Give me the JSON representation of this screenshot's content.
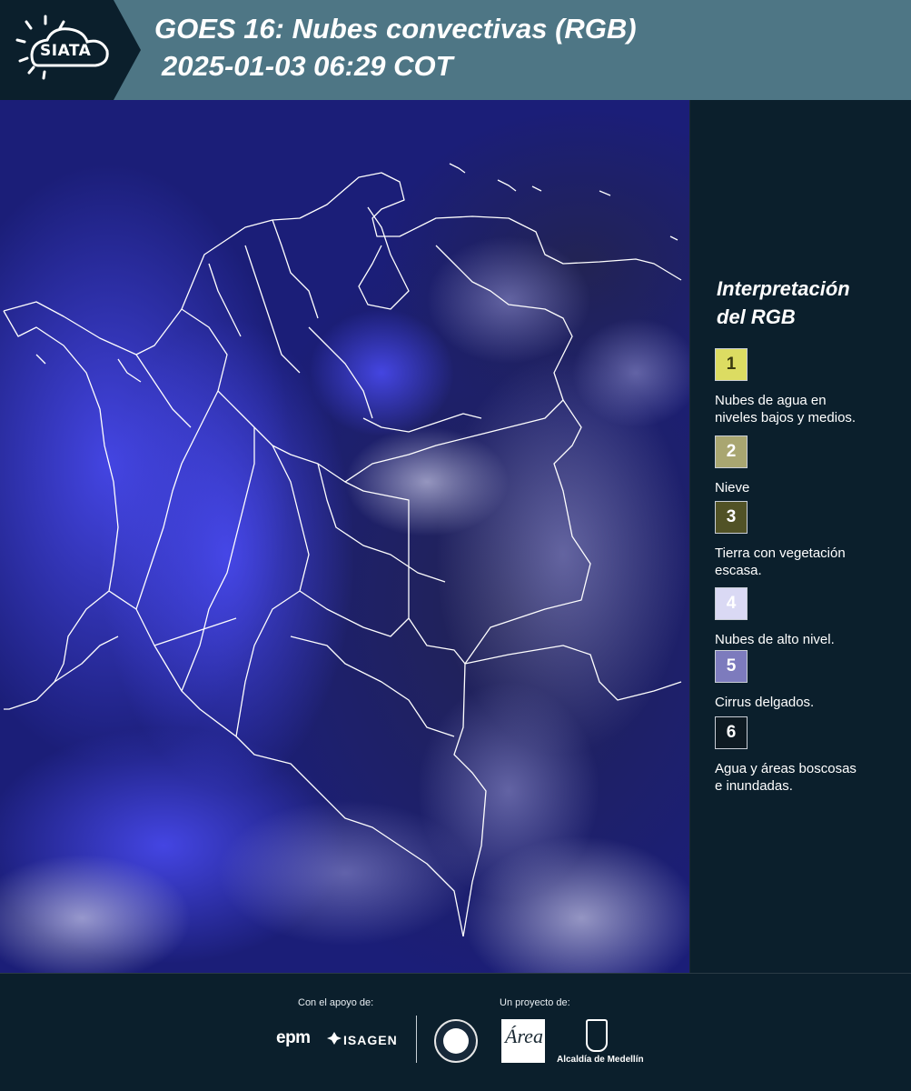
{
  "header": {
    "logo_text": "SIATA",
    "title_line1": "GOES 16: Nubes convectivas (RGB)",
    "title_line2": "2025-01-03 06:29 COT",
    "bg_color": "#4e7685"
  },
  "map": {
    "description_icon": "satellite-map",
    "background_color": "#1a1d6e"
  },
  "legend": {
    "title_line1": "Interpretación",
    "title_line2": "del RGB",
    "items": [
      {
        "number": "1",
        "label_line1": "Nubes de agua en",
        "label_line2": "niveles bajos y medios.",
        "color": "#dcdc62"
      },
      {
        "number": "2",
        "label_line1": "Nieve",
        "label_line2": "",
        "color": "#a9a671"
      },
      {
        "number": "3",
        "label_line1": "Tierra con vegetación",
        "label_line2": "escasa.",
        "color": "#515226"
      },
      {
        "number": "4",
        "label_line1": "Nubes de alto nivel.",
        "label_line2": "",
        "color": "#dad9f4"
      },
      {
        "number": "5",
        "label_line1": "Cirrus delgados.",
        "label_line2": "",
        "color": "#7d7bbd"
      },
      {
        "number": "6",
        "label_line1": "Agua y áreas boscosas",
        "label_line2": "e inundadas.",
        "color": "#0e1a22"
      }
    ]
  },
  "footer": {
    "support_label": "Con el apoyo de:",
    "project_label": "Un proyecto de:",
    "epm": "epm",
    "isagen": "ISAGEN",
    "area_metropolitana": "Área",
    "alcaldia": "Alcaldía de Medellín"
  }
}
